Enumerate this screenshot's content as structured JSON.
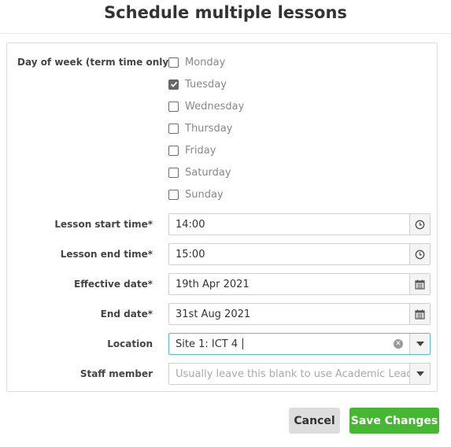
{
  "dialog": {
    "title": "Schedule multiple lessons"
  },
  "days": {
    "label": "Day of week (term time only)",
    "items": [
      {
        "label": "Monday",
        "checked": false
      },
      {
        "label": "Tuesday",
        "checked": true
      },
      {
        "label": "Wednesday",
        "checked": false
      },
      {
        "label": "Thursday",
        "checked": false
      },
      {
        "label": "Friday",
        "checked": false
      },
      {
        "label": "Saturday",
        "checked": false
      },
      {
        "label": "Sunday",
        "checked": false
      }
    ]
  },
  "fields": {
    "start_time": {
      "label": "Lesson start time*",
      "value": "14:00",
      "icon": "clock-icon"
    },
    "end_time": {
      "label": "Lesson end time*",
      "value": "15:00",
      "icon": "clock-icon"
    },
    "effective_date": {
      "label": "Effective date*",
      "value": "19th Apr 2021",
      "icon": "calendar-icon"
    },
    "end_date": {
      "label": "End date*",
      "value": "31st Aug 2021",
      "icon": "calendar-icon"
    },
    "location": {
      "label": "Location",
      "value": "Site 1: ICT 4",
      "icon": "chevron-down-icon"
    },
    "staff": {
      "label": "Staff member",
      "placeholder": "Usually leave this blank to use Academic Leads",
      "icon": "chevron-down-icon"
    }
  },
  "buttons": {
    "cancel": "Cancel",
    "save": "Save Changes"
  },
  "colors": {
    "accent_focus": "#4fc0c8",
    "save": "#46b733",
    "cancel": "#dddddd"
  }
}
